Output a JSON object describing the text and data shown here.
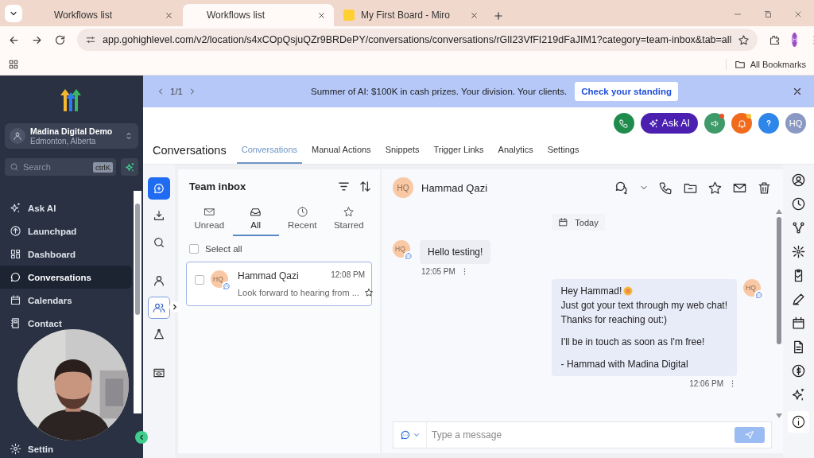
{
  "browser": {
    "tabs": [
      {
        "title": "Workflows list",
        "selected": false,
        "kind": "plain"
      },
      {
        "title": "Workflows list",
        "selected": true,
        "kind": "plain"
      },
      {
        "title": "My First Board - Miro",
        "selected": false,
        "kind": "miro"
      }
    ],
    "url": "app.gohighlevel.com/v2/location/s4xCOpQsjuQZr9BRDePY/conversations/conversations/rGlI23VfFI219dFaJIM1?category=team-inbox&tab=all",
    "profile": "H",
    "bookmarks": "All Bookmarks"
  },
  "sidebar": {
    "account": {
      "name": "Madina Digital Demo",
      "location": "Edmonton, Alberta"
    },
    "search": {
      "placeholder": "Search",
      "shortcut": "ctrlK"
    },
    "items": [
      {
        "label": "Ask AI",
        "selected": false
      },
      {
        "label": "Launchpad",
        "selected": false
      },
      {
        "label": "Dashboard",
        "selected": false
      },
      {
        "label": "Conversations",
        "selected": true
      },
      {
        "label": "Calendars",
        "selected": false
      },
      {
        "label": "Contact",
        "selected": false
      }
    ],
    "settings": "Settin"
  },
  "banner": {
    "pager": "1/1",
    "text": "Summer of AI: $100K in cash prizes. Your division. Your clients.",
    "cta": "Check your standing"
  },
  "topbar": {
    "ask_ai": "Ask AI",
    "avatar": "HQ"
  },
  "header": {
    "title": "Conversations",
    "tabs": [
      {
        "label": "Conversations",
        "selected": true
      },
      {
        "label": "Manual Actions",
        "selected": false
      },
      {
        "label": "Snippets",
        "selected": false
      },
      {
        "label": "Trigger Links",
        "selected": false
      },
      {
        "label": "Analytics",
        "selected": false
      },
      {
        "label": "Settings",
        "selected": false
      }
    ]
  },
  "inbox": {
    "title": "Team inbox",
    "filters": [
      {
        "label": "Unread",
        "selected": false
      },
      {
        "label": "All",
        "selected": true
      },
      {
        "label": "Recent",
        "selected": false
      },
      {
        "label": "Starred",
        "selected": false
      }
    ],
    "select_all": {
      "label": "Select all",
      "checked": false
    },
    "conversations": [
      {
        "avatar": "HQ",
        "name": "Hammad Qazi",
        "time": "12:08 PM",
        "preview": "Look forward to hearing from ...",
        "selected": true,
        "checked": false
      }
    ]
  },
  "chat": {
    "contact": {
      "avatar": "HQ",
      "name": "Hammad Qazi"
    },
    "date": "Today",
    "messages": [
      {
        "kind": "incoming",
        "avatar": "HQ",
        "paragraphs": [
          [
            "Hello testing!"
          ]
        ],
        "time": "12:05 PM"
      },
      {
        "kind": "outgoing",
        "avatar": "HQ",
        "paragraphs": [
          [
            "Hey Hammad!",
            "Just got your text through my web chat!",
            "Thanks for reaching out:)"
          ],
          [
            "I'll be in touch as soon as I'm free!"
          ],
          [
            "- Hammad with Madina Digital"
          ]
        ],
        "time": "12:06 PM"
      }
    ],
    "composer": {
      "placeholder": "Type a message"
    }
  }
}
